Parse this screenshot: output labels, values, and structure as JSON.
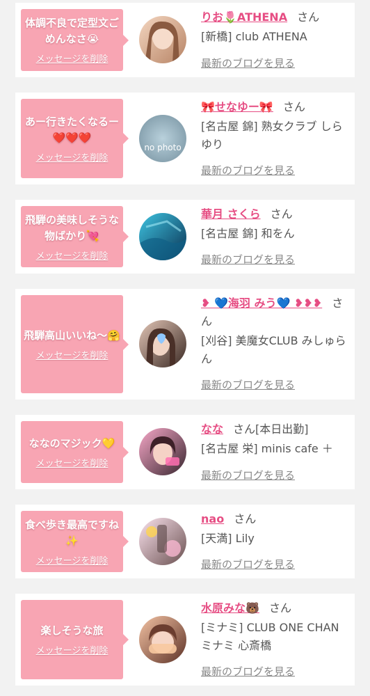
{
  "cards": [
    {
      "message": "体調不良で定型文ごめんなさ😭",
      "delete_label": "メッセージを削除",
      "name": "りお🌷ATHENA",
      "honorific": "さん",
      "shop": "[新橋] club ATHENA",
      "blog_label": "最新のブログを見る",
      "avatar_colors": [
        "#d9a98b",
        "#5a4034"
      ]
    },
    {
      "message": "あー行きたくなるー❤️❤️❤️",
      "delete_label": "メッセージを削除",
      "name": "🎀せなゆー🎀",
      "honorific": "さん",
      "shop": "[名古屋 錦] 熟女クラブ しらゆり",
      "blog_label": "最新のブログを見る",
      "avatar_text": "no photo",
      "avatar_colors": [
        "#a9c3cf",
        "#6e8b98"
      ]
    },
    {
      "message": "飛騨の美味しそうな物ばかり💘",
      "delete_label": "メッセージを削除",
      "name": "華月 さくら",
      "honorific": "さん",
      "shop": "[名古屋 錦] 和をん",
      "blog_label": "最新のブログを見る",
      "avatar_colors": [
        "#2aa8c9",
        "#0b3d63"
      ]
    },
    {
      "message": "飛騨高山いいね〜🤗",
      "delete_label": "メッセージを削除",
      "name": "❥ 💙海羽 みう💙 ❥❥❥",
      "honorific": "さん",
      "shop": "[刈谷] 美魔女CLUB みしゅらん",
      "blog_label": "最新のブログを見る",
      "avatar_colors": [
        "#c9a495",
        "#3b2a24"
      ]
    },
    {
      "message": "ななのマジック💛",
      "delete_label": "メッセージを削除",
      "name": "なな",
      "honorific": "さん",
      "status": "[本日出勤]",
      "shop": "[名古屋 栄] minis cafe ＋",
      "blog_label": "最新のブログを見る",
      "avatar_colors": [
        "#f07cab",
        "#3a2730"
      ]
    },
    {
      "message": "食べ歩き最高ですね✨",
      "delete_label": "メッセージを削除",
      "name": "nao",
      "honorific": "さん",
      "shop": "[天満] Lily",
      "blog_label": "最新のブログを見る",
      "avatar_colors": [
        "#e8c6d8",
        "#4a3a3a"
      ]
    },
    {
      "message": "楽しそうな旅",
      "delete_label": "メッセージを削除",
      "name": "水原みな🐻",
      "honorific": "さん",
      "shop": "[ミナミ] CLUB ONE CHAN ミナミ 心斎橋",
      "blog_label": "最新のブログを見る",
      "avatar_colors": [
        "#e3a986",
        "#6b3d2f"
      ]
    }
  ]
}
